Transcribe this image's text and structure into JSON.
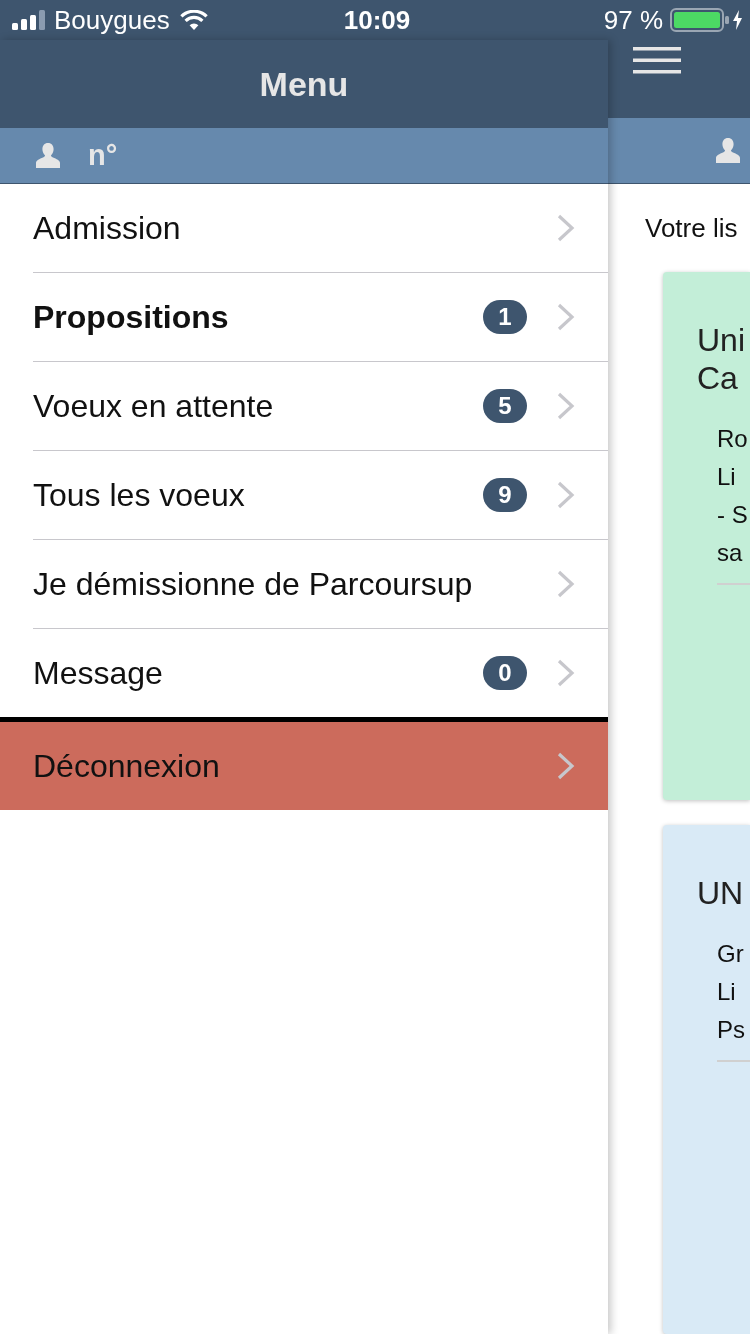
{
  "status_bar": {
    "carrier": "Bouygues",
    "time": "10:09",
    "battery": "97 %"
  },
  "menu": {
    "title": "Menu",
    "user_label": "n°",
    "items": [
      {
        "label": "Admission",
        "bold": false
      },
      {
        "label": "Propositions",
        "bold": true,
        "badge": "1"
      },
      {
        "label": "Voeux en attente",
        "bold": false,
        "badge": "5"
      },
      {
        "label": "Tous les voeux",
        "bold": false,
        "badge": "9"
      },
      {
        "label": "Je démissionne de Parcoursup",
        "bold": false
      },
      {
        "label": "Message",
        "bold": false,
        "badge": "0"
      }
    ],
    "logout": {
      "label": "Déconnexion"
    }
  },
  "main": {
    "intro": "Votre lis",
    "cards": [
      {
        "color": "#c3eed8",
        "title_lines": [
          "Uni",
          "Ca"
        ],
        "detail_lines": [
          "Ro",
          "Li",
          "- S",
          "sa"
        ]
      },
      {
        "color": "#d9eaf6",
        "title_lines": [
          "UN"
        ],
        "detail_lines": [
          "Gr",
          "Li",
          "Ps"
        ]
      }
    ]
  }
}
